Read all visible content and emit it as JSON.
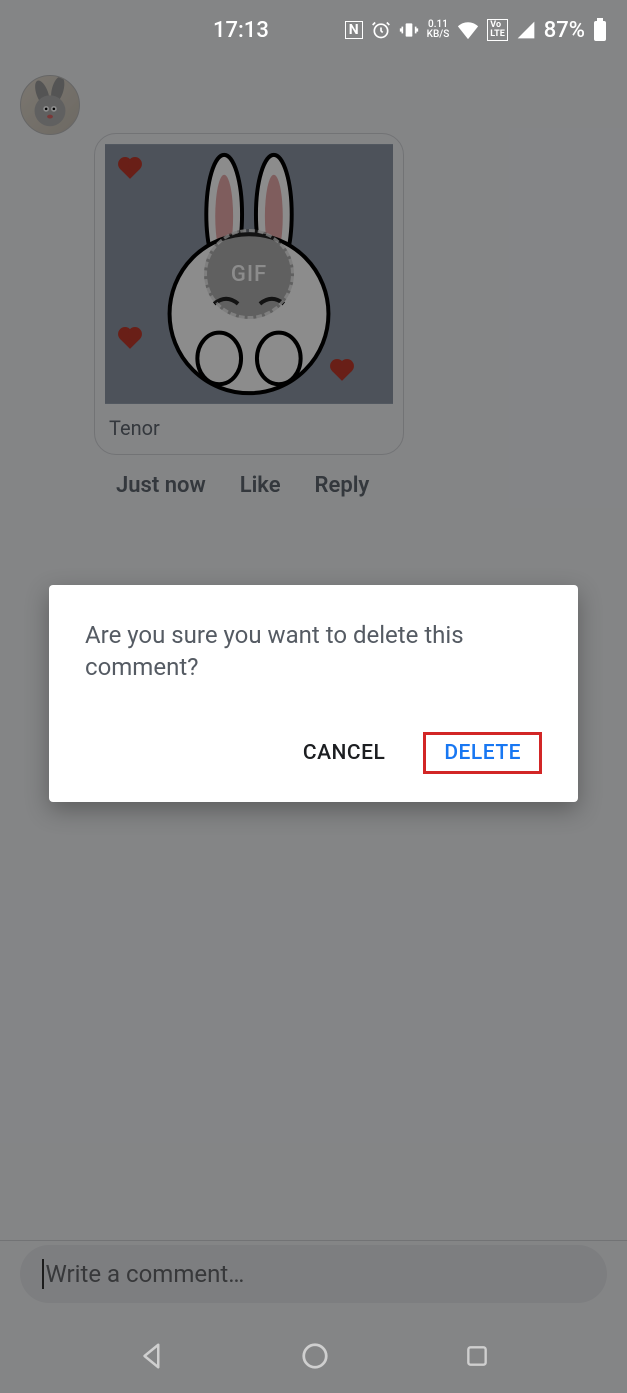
{
  "status": {
    "time": "17:13",
    "kbs_value": "0.11",
    "kbs_label": "KB/S",
    "lte": "Vo\nLTE",
    "battery_pct": "87%"
  },
  "comment": {
    "source": "Tenor",
    "gif_label": "GIF",
    "timestamp": "Just now",
    "like_label": "Like",
    "reply_label": "Reply"
  },
  "dialog": {
    "message": "Are you sure you want to delete this comment?",
    "cancel_label": "CANCEL",
    "delete_label": "DELETE"
  },
  "input": {
    "placeholder": "Write a comment…"
  }
}
